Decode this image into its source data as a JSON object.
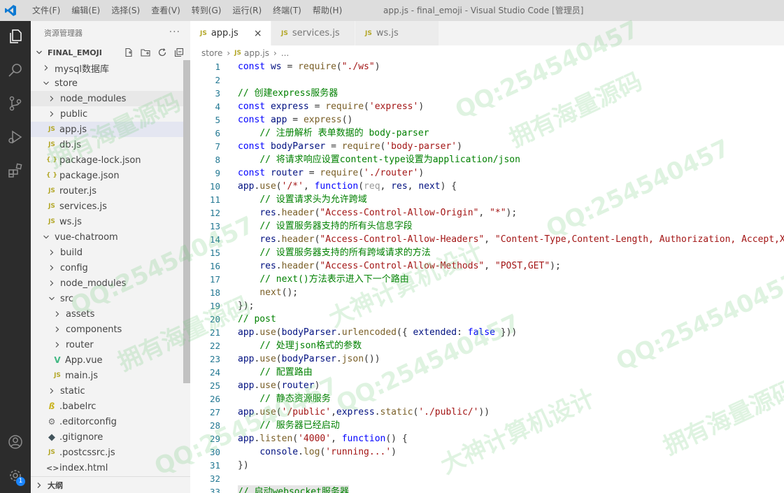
{
  "window": {
    "title": "app.js - final_emoji - Visual Studio Code [管理员]",
    "menu": [
      "文件(F)",
      "编辑(E)",
      "选择(S)",
      "查看(V)",
      "转到(G)",
      "运行(R)",
      "终端(T)",
      "帮助(H)"
    ]
  },
  "activity_bar": {
    "items": [
      "files-icon",
      "search-icon",
      "source-control-icon",
      "run-debug-icon",
      "extensions-icon"
    ],
    "bottom": [
      "account-icon",
      "manage-gear-icon"
    ],
    "badge": "1"
  },
  "sidebar": {
    "title": "资源管理器",
    "more": "···",
    "root": "FINAL_EMOJI",
    "outline": "大纲",
    "tree": [
      {
        "label": "mysql数据库",
        "depth": 0,
        "kind": "folder",
        "open": false
      },
      {
        "label": "store",
        "depth": 0,
        "kind": "folder",
        "open": true
      },
      {
        "label": "node_modules",
        "depth": 1,
        "kind": "folder",
        "open": false,
        "state": "hover"
      },
      {
        "label": "public",
        "depth": 1,
        "kind": "folder",
        "open": false
      },
      {
        "label": "app.js",
        "depth": 1,
        "kind": "js",
        "state": "selected"
      },
      {
        "label": "db.js",
        "depth": 1,
        "kind": "js"
      },
      {
        "label": "package-lock.json",
        "depth": 1,
        "kind": "json"
      },
      {
        "label": "package.json",
        "depth": 1,
        "kind": "json"
      },
      {
        "label": "router.js",
        "depth": 1,
        "kind": "js"
      },
      {
        "label": "services.js",
        "depth": 1,
        "kind": "js"
      },
      {
        "label": "ws.js",
        "depth": 1,
        "kind": "js"
      },
      {
        "label": "vue-chatroom",
        "depth": 0,
        "kind": "folder",
        "open": true
      },
      {
        "label": "build",
        "depth": 1,
        "kind": "folder",
        "open": false
      },
      {
        "label": "config",
        "depth": 1,
        "kind": "folder",
        "open": false
      },
      {
        "label": "node_modules",
        "depth": 1,
        "kind": "folder",
        "open": false
      },
      {
        "label": "src",
        "depth": 1,
        "kind": "folder",
        "open": true
      },
      {
        "label": "assets",
        "depth": 2,
        "kind": "folder",
        "open": false
      },
      {
        "label": "components",
        "depth": 2,
        "kind": "folder",
        "open": false
      },
      {
        "label": "router",
        "depth": 2,
        "kind": "folder",
        "open": false
      },
      {
        "label": "App.vue",
        "depth": 2,
        "kind": "vue"
      },
      {
        "label": "main.js",
        "depth": 2,
        "kind": "js"
      },
      {
        "label": "static",
        "depth": 1,
        "kind": "folder",
        "open": false
      },
      {
        "label": ".babelrc",
        "depth": 1,
        "kind": "babel"
      },
      {
        "label": ".editorconfig",
        "depth": 1,
        "kind": "gear"
      },
      {
        "label": ".gitignore",
        "depth": 1,
        "kind": "git"
      },
      {
        "label": ".postcssrc.js",
        "depth": 1,
        "kind": "js"
      },
      {
        "label": "index.html",
        "depth": 1,
        "kind": "html"
      }
    ]
  },
  "editor": {
    "tabs": [
      {
        "label": "app.js",
        "active": true,
        "close": "×"
      },
      {
        "label": "services.js",
        "active": false
      },
      {
        "label": "ws.js",
        "active": false
      }
    ],
    "breadcrumb": [
      "store",
      "app.js",
      "..."
    ],
    "lines": [
      [
        [
          "kw",
          "const"
        ],
        [
          "t",
          " "
        ],
        [
          "vr",
          "ws"
        ],
        [
          "t",
          " = "
        ],
        [
          "fn",
          "require"
        ],
        [
          "t",
          "("
        ],
        [
          "str",
          "\"./ws\""
        ],
        [
          "t",
          ")"
        ]
      ],
      [],
      [
        [
          "cm",
          "// 创建express服务器"
        ]
      ],
      [
        [
          "kw",
          "const"
        ],
        [
          "t",
          " "
        ],
        [
          "vr",
          "express"
        ],
        [
          "t",
          " = "
        ],
        [
          "fn",
          "require"
        ],
        [
          "t",
          "("
        ],
        [
          "str",
          "'express'"
        ],
        [
          "t",
          ")"
        ]
      ],
      [
        [
          "kw",
          "const"
        ],
        [
          "t",
          " "
        ],
        [
          "vr",
          "app"
        ],
        [
          "t",
          " = "
        ],
        [
          "fn",
          "express"
        ],
        [
          "t",
          "()"
        ]
      ],
      [
        [
          "t",
          "    "
        ],
        [
          "cm",
          "// 注册解析 表单数据的 body-parser"
        ]
      ],
      [
        [
          "kw",
          "const"
        ],
        [
          "t",
          " "
        ],
        [
          "vr",
          "bodyParser"
        ],
        [
          "t",
          " = "
        ],
        [
          "fn",
          "require"
        ],
        [
          "t",
          "("
        ],
        [
          "str",
          "'body-parser'"
        ],
        [
          "t",
          ")"
        ]
      ],
      [
        [
          "t",
          "    "
        ],
        [
          "cm",
          "// 将请求响应设置content-type设置为application/json"
        ]
      ],
      [
        [
          "kw",
          "const"
        ],
        [
          "t",
          " "
        ],
        [
          "vr",
          "router"
        ],
        [
          "t",
          " = "
        ],
        [
          "fn",
          "require"
        ],
        [
          "t",
          "("
        ],
        [
          "str",
          "'./router'"
        ],
        [
          "t",
          ")"
        ]
      ],
      [
        [
          "vr",
          "app"
        ],
        [
          "t",
          "."
        ],
        [
          "fn",
          "use"
        ],
        [
          "t",
          "("
        ],
        [
          "str",
          "'/*'"
        ],
        [
          "t",
          ", "
        ],
        [
          "kw",
          "function"
        ],
        [
          "t",
          "("
        ],
        [
          "pm",
          "req"
        ],
        [
          "t",
          ", "
        ],
        [
          "vr",
          "res"
        ],
        [
          "t",
          ", "
        ],
        [
          "vr",
          "next"
        ],
        [
          "t",
          ") {"
        ]
      ],
      [
        [
          "t",
          "    "
        ],
        [
          "cm",
          "// 设置请求头为允许跨域"
        ]
      ],
      [
        [
          "t",
          "    "
        ],
        [
          "vr",
          "res"
        ],
        [
          "t",
          "."
        ],
        [
          "fn",
          "header"
        ],
        [
          "t",
          "("
        ],
        [
          "str",
          "\"Access-Control-Allow-Origin\""
        ],
        [
          "t",
          ", "
        ],
        [
          "str",
          "\"*\""
        ],
        [
          "t",
          ");"
        ]
      ],
      [
        [
          "t",
          "    "
        ],
        [
          "cm",
          "// 设置服务器支持的所有头信息字段"
        ]
      ],
      [
        [
          "t",
          "    "
        ],
        [
          "vr",
          "res"
        ],
        [
          "t",
          "."
        ],
        [
          "fn",
          "header"
        ],
        [
          "t",
          "("
        ],
        [
          "str",
          "\"Access-Control-Allow-Headers\""
        ],
        [
          "t",
          ", "
        ],
        [
          "str",
          "\"Content-Type,Content-Length, Authorization, Accept,X-Re"
        ]
      ],
      [
        [
          "t",
          "    "
        ],
        [
          "cm",
          "// 设置服务器支持的所有跨域请求的方法"
        ]
      ],
      [
        [
          "t",
          "    "
        ],
        [
          "vr",
          "res"
        ],
        [
          "t",
          "."
        ],
        [
          "fn",
          "header"
        ],
        [
          "t",
          "("
        ],
        [
          "str",
          "\"Access-Control-Allow-Methods\""
        ],
        [
          "t",
          ", "
        ],
        [
          "str",
          "\"POST,GET\""
        ],
        [
          "t",
          ");"
        ]
      ],
      [
        [
          "t",
          "    "
        ],
        [
          "cm",
          "// next()方法表示进入下一个路由"
        ]
      ],
      [
        [
          "t",
          "    "
        ],
        [
          "fn",
          "next"
        ],
        [
          "t",
          "();"
        ]
      ],
      [
        [
          "t",
          "});"
        ]
      ],
      [
        [
          "cm",
          "// post"
        ]
      ],
      [
        [
          "vr",
          "app"
        ],
        [
          "t",
          "."
        ],
        [
          "fn",
          "use"
        ],
        [
          "t",
          "("
        ],
        [
          "vr",
          "bodyParser"
        ],
        [
          "t",
          "."
        ],
        [
          "fn",
          "urlencoded"
        ],
        [
          "t",
          "({ "
        ],
        [
          "vr",
          "extended"
        ],
        [
          "t",
          ": "
        ],
        [
          "kw",
          "false"
        ],
        [
          "t",
          " }))"
        ]
      ],
      [
        [
          "t",
          "    "
        ],
        [
          "cm",
          "// 处理json格式的参数"
        ]
      ],
      [
        [
          "vr",
          "app"
        ],
        [
          "t",
          "."
        ],
        [
          "fn",
          "use"
        ],
        [
          "t",
          "("
        ],
        [
          "vr",
          "bodyParser"
        ],
        [
          "t",
          "."
        ],
        [
          "fn",
          "json"
        ],
        [
          "t",
          "())"
        ]
      ],
      [
        [
          "t",
          "    "
        ],
        [
          "cm",
          "// 配置路由"
        ]
      ],
      [
        [
          "vr",
          "app"
        ],
        [
          "t",
          "."
        ],
        [
          "fn",
          "use"
        ],
        [
          "t",
          "("
        ],
        [
          "vr",
          "router"
        ],
        [
          "t",
          ")"
        ]
      ],
      [
        [
          "t",
          "    "
        ],
        [
          "cm",
          "// 静态资源服务"
        ]
      ],
      [
        [
          "vr",
          "app"
        ],
        [
          "t",
          "."
        ],
        [
          "fn",
          "use"
        ],
        [
          "t",
          "("
        ],
        [
          "str",
          "'/public'"
        ],
        [
          "t",
          ","
        ],
        [
          "vr",
          "express"
        ],
        [
          "t",
          "."
        ],
        [
          "fn",
          "static"
        ],
        [
          "t",
          "("
        ],
        [
          "str",
          "'./public/'"
        ],
        [
          "t",
          "))"
        ]
      ],
      [
        [
          "t",
          "    "
        ],
        [
          "cm",
          "// 服务器已经启动"
        ]
      ],
      [
        [
          "vr",
          "app"
        ],
        [
          "t",
          "."
        ],
        [
          "fn",
          "listen"
        ],
        [
          "t",
          "("
        ],
        [
          "str",
          "'4000'"
        ],
        [
          "t",
          ", "
        ],
        [
          "kw",
          "function"
        ],
        [
          "t",
          "() {"
        ]
      ],
      [
        [
          "t",
          "    "
        ],
        [
          "vr",
          "console"
        ],
        [
          "t",
          "."
        ],
        [
          "fn",
          "log"
        ],
        [
          "t",
          "("
        ],
        [
          "str",
          "'running...'"
        ],
        [
          "t",
          ")"
        ]
      ],
      [
        [
          "t",
          "})"
        ]
      ],
      [],
      [
        [
          "cm",
          "// 启动websocket服务器"
        ]
      ]
    ]
  },
  "watermark": {
    "qq": "QQ:254540457",
    "brand": "拥有海量源码",
    "studio": "大神计算机设计"
  },
  "colors": {
    "keyword": "#0000ff",
    "comment": "#008000",
    "string": "#a31515",
    "function": "#795e26",
    "variable": "#001080",
    "line_number": "#237893",
    "activity_bar": "#2c2c2c",
    "sidebar": "#f3f3f3"
  }
}
